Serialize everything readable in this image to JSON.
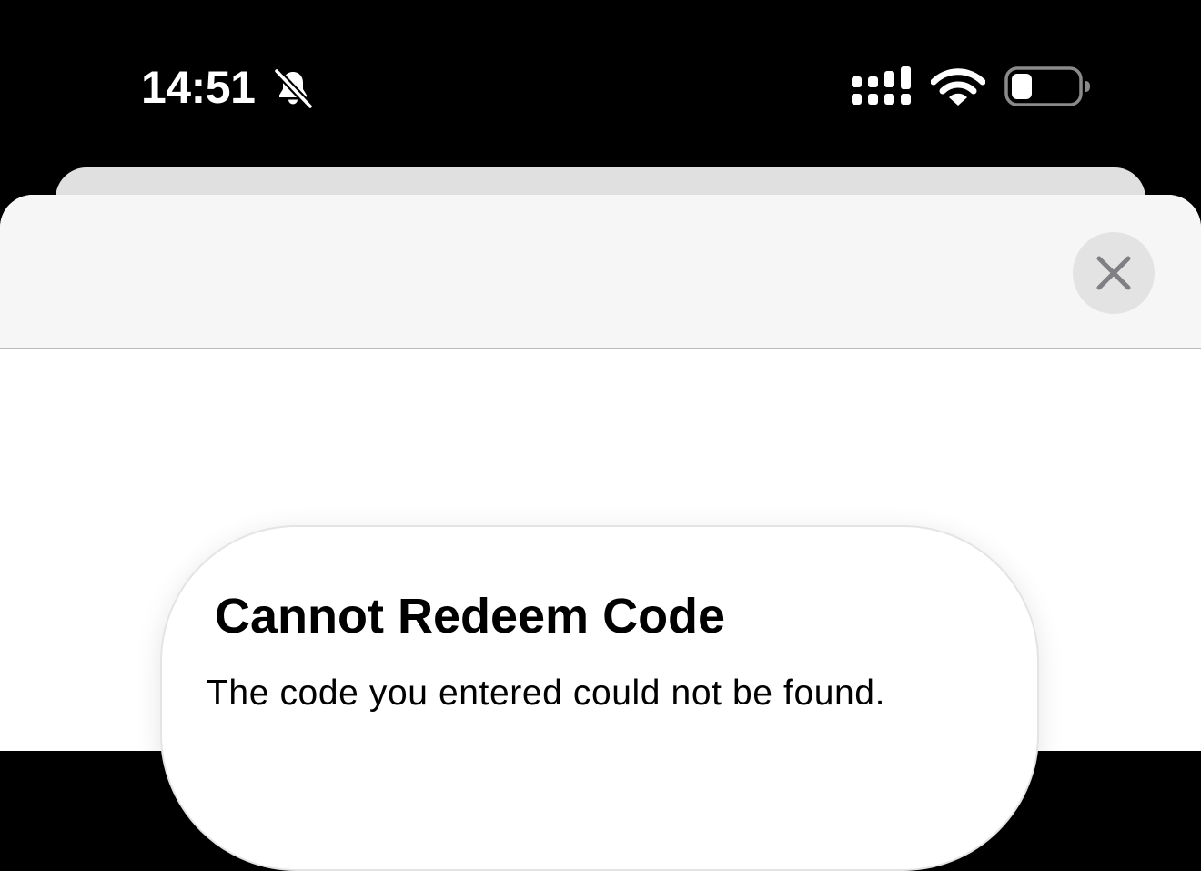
{
  "status_bar": {
    "time": "14:51",
    "icons": {
      "silent_mode": "bell-slash-icon",
      "cellular": "signal-icon",
      "wifi": "wifi-icon",
      "battery": "battery-icon"
    },
    "battery_level": 0.15
  },
  "sheet": {
    "close_icon": "close-icon"
  },
  "alert": {
    "title": "Cannot Redeem Code",
    "message": "The code you entered could not be found."
  },
  "colors": {
    "background": "#000000",
    "sheet_header": "#f6f6f6",
    "back_sheet": "#e0e0e0",
    "close_button": "#e3e3e3",
    "close_glyph": "#7f7f84",
    "text": "#000000"
  }
}
